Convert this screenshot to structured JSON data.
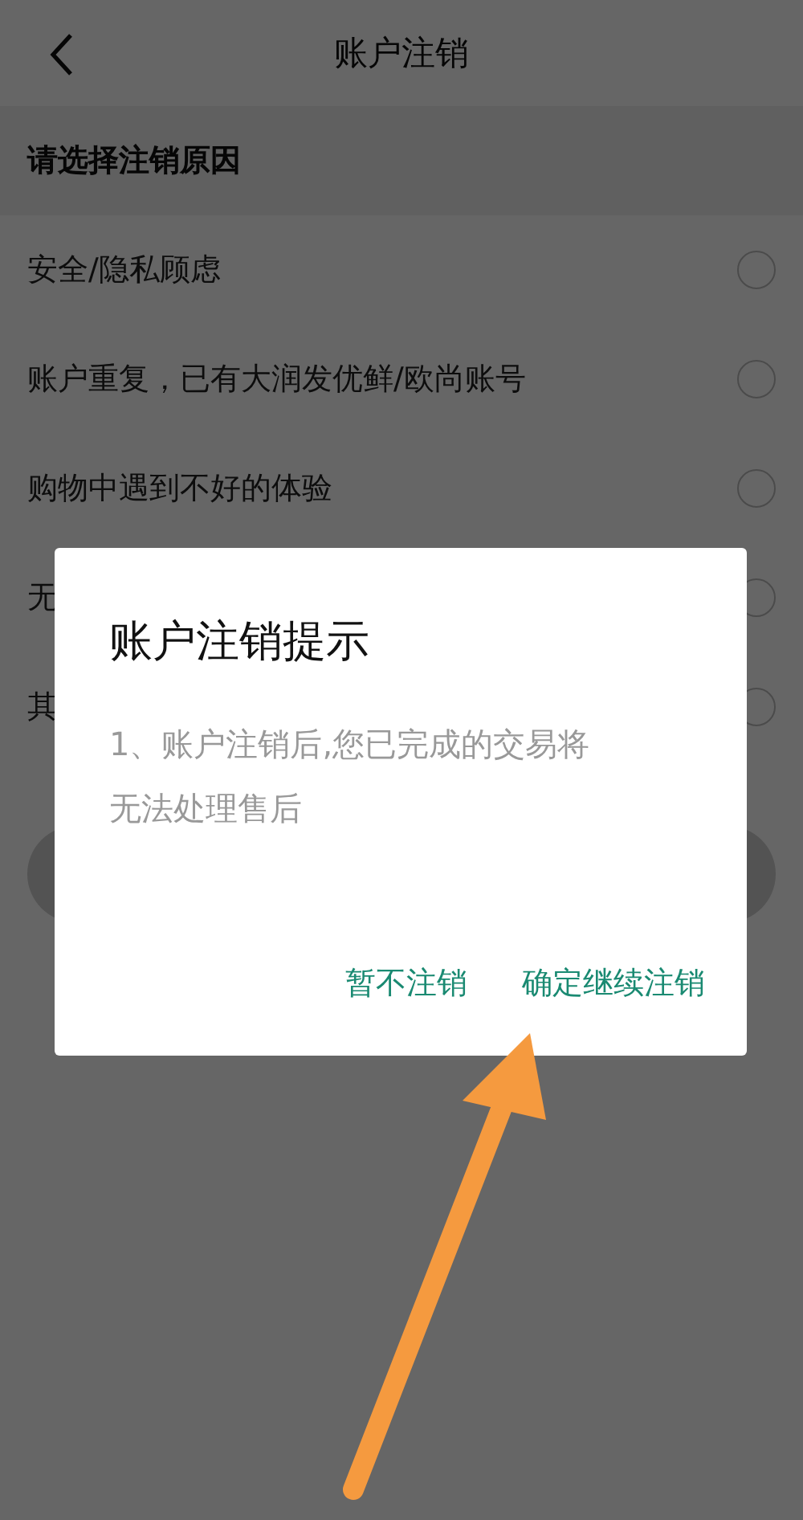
{
  "header": {
    "title": "账户注销"
  },
  "section": {
    "title": "请选择注销原因"
  },
  "reasons": [
    {
      "label": "安全/隐私顾虑",
      "checked": false
    },
    {
      "label": "账户重复，已有大润发优鲜/欧尚账号",
      "checked": false
    },
    {
      "label": "购物中遇到不好的体验",
      "checked": false
    },
    {
      "label": "无",
      "checked": false
    },
    {
      "label": "其",
      "checked": false
    }
  ],
  "dialog": {
    "title": "账户注销提示",
    "message": "1、账户注销后,您已完成的交易将无法处理售后",
    "buttons": [
      {
        "label": "暂不注销"
      },
      {
        "label": "确定继续注销"
      }
    ]
  }
}
